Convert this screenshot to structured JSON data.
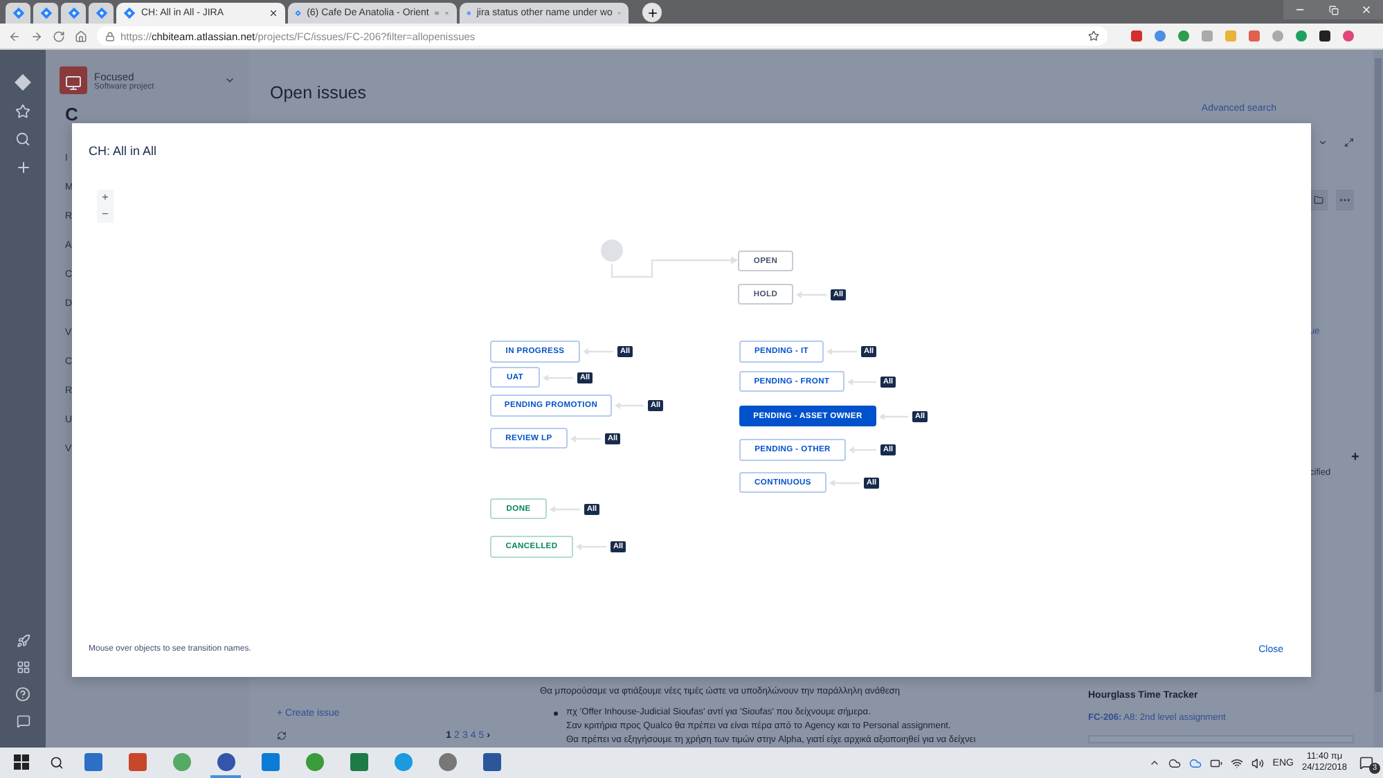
{
  "browser": {
    "tabs": [
      {
        "title": "CH: All in All - JIRA",
        "selected": true,
        "audio": false
      },
      {
        "title": "(6) Cafe De Anatolia - Orient",
        "selected": false,
        "audio": true
      },
      {
        "title": "jira status other name under wo",
        "selected": false,
        "audio": false
      }
    ],
    "address": {
      "scheme": "https://",
      "host": "chbiteam.atlassian.net",
      "path": "/projects/FC/issues/FC-206?filter=allopenissues"
    }
  },
  "project": {
    "name": "Focused",
    "type": "Software project"
  },
  "sidebar": {
    "heading": "C",
    "items": [
      "I",
      "M",
      "R",
      "A",
      "C",
      "D",
      "V",
      "C",
      "R",
      "U",
      "V"
    ]
  },
  "page": {
    "title": "Open issues",
    "advanced_search": "Advanced search"
  },
  "issue_list": {
    "create": "+ Create issue",
    "pages": [
      {
        "label": "1",
        "selected": true
      },
      {
        "label": "2",
        "selected": false
      },
      {
        "label": "3",
        "selected": false
      },
      {
        "label": "4",
        "selected": false
      },
      {
        "label": "5",
        "selected": false
      }
    ],
    "next": "›"
  },
  "detail": {
    "intro": "Θα μπορούσαμε να φτιάξουμε νέες τιμές ώστε να υποδηλώνουν την παράλληλη ανάθεση",
    "bullet_lines": [
      "πχ 'Offer Inhouse-Judicial Sioufas' αντί για 'Sioufas' που δείχνουμε σήμερα.",
      "Σαν κριτήρια προς Qualco θα πρέπει να είναι πέρα από το Agency και το Personal assignment.",
      "Θα πρέπει να εξηγήσουμε τη χρήση των τιμών στην Alpha, γιατί είχε αρχικά αξιοποιηθεί για να δείχνει"
    ]
  },
  "side_fragments": {
    "link": "ue",
    "add": "+",
    "field": "cified"
  },
  "time_tracker": {
    "title": "Hourglass Time Tracker",
    "issue_key": "FC-206:",
    "issue_summary": "A8: 2nd level assignment"
  },
  "modal": {
    "title": "CH: All in All",
    "zoom_in": "+",
    "zoom_out": "−",
    "hint": "Mouse over objects to see transition names.",
    "close": "Close",
    "statuses": [
      {
        "label": "OPEN",
        "color": "#42526e",
        "selected": false
      },
      {
        "label": "HOLD",
        "color": "#42526e",
        "selected": false,
        "transition": "All"
      },
      {
        "label": "IN PROGRESS",
        "color": "#0052cc",
        "selected": false,
        "transition": "All"
      },
      {
        "label": "PENDING - IT",
        "color": "#0052cc",
        "selected": false,
        "transition": "All"
      },
      {
        "label": "UAT",
        "color": "#0052cc",
        "selected": false,
        "transition": "All"
      },
      {
        "label": "PENDING - FRONT",
        "color": "#0052cc",
        "selected": false,
        "transition": "All"
      },
      {
        "label": "PENDING PROMOTION",
        "color": "#0052cc",
        "selected": false,
        "transition": "All"
      },
      {
        "label": "PENDING - ASSET OWNER",
        "color": "#0052cc",
        "selected": true,
        "transition": "All"
      },
      {
        "label": "REVIEW LP",
        "color": "#0052cc",
        "selected": false,
        "transition": "All"
      },
      {
        "label": "PENDING - OTHER",
        "color": "#0052cc",
        "selected": false,
        "transition": "All"
      },
      {
        "label": "CONTINUOUS",
        "color": "#0052cc",
        "selected": false,
        "transition": "All"
      },
      {
        "label": "DONE",
        "color": "#00875a",
        "selected": false,
        "transition": "All"
      },
      {
        "label": "CANCELLED",
        "color": "#00875a",
        "selected": false,
        "transition": "All"
      }
    ]
  },
  "taskbar": {
    "language": "ENG",
    "time": "11:40 πμ",
    "date": "24/12/2018",
    "notifications": "3"
  }
}
